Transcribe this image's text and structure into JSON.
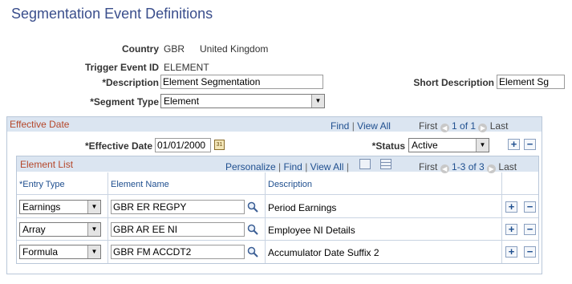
{
  "page": {
    "title": "Segmentation Event Definitions"
  },
  "header": {
    "country_label": "Country",
    "country_code": "GBR",
    "country_name": "United Kingdom",
    "trigger_label": "Trigger Event ID",
    "trigger_value": "ELEMENT",
    "description_label": "*Description",
    "description_value": "Element Segmentation",
    "short_desc_label": "Short Description",
    "short_desc_value": "Element Sg",
    "segment_type_label": "*Segment Type",
    "segment_type_value": "Element"
  },
  "effective_date": {
    "title": "Effective Date",
    "find": "Find",
    "sep": "|",
    "view_all": "View All",
    "first": "First",
    "count": "1 of 1",
    "last": "Last",
    "date_label": "*Effective Date",
    "date_value": "01/01/2000",
    "status_label": "*Status",
    "status_value": "Active"
  },
  "element_list": {
    "title": "Element List",
    "personalize": "Personalize",
    "find": "Find",
    "sep": "|",
    "view_all": "View All",
    "first": "First",
    "count": "1-3 of 3",
    "last": "Last",
    "columns": {
      "entry_type": "*Entry Type",
      "element_name": "Element Name",
      "description": "Description"
    },
    "rows": [
      {
        "entry_type": "Earnings",
        "element_name": "GBR ER REGPY",
        "description": "Period Earnings"
      },
      {
        "entry_type": "Array",
        "element_name": "GBR AR EE NI",
        "description": "Employee NI Details"
      },
      {
        "entry_type": "Formula",
        "element_name": "GBR FM ACCDT2",
        "description": "Accumulator Date Suffix 2"
      }
    ]
  },
  "icons": {
    "add": "+",
    "delete": "−",
    "dropdown": "▼",
    "prev": "◀",
    "next": "▶"
  },
  "colors": {
    "title": "#3a4e8c",
    "group_title": "#b5472a",
    "link": "#1f4f8f",
    "header_band": "#dbe5f1"
  }
}
